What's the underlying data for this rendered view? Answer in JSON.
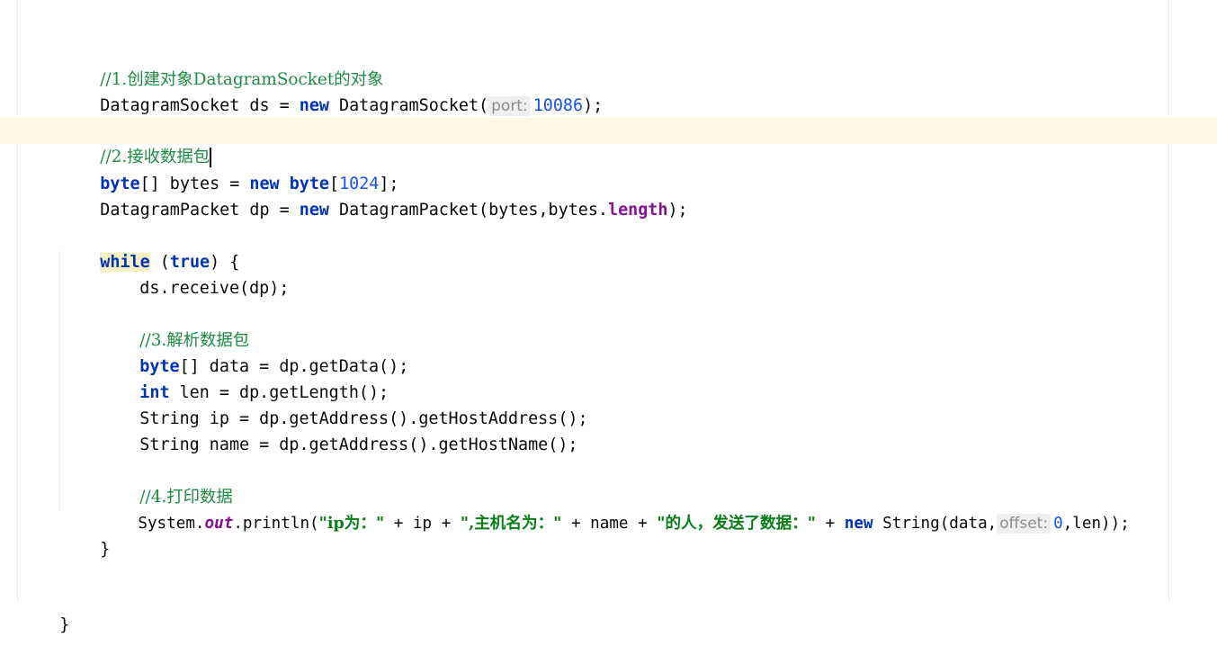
{
  "code": {
    "line1": {
      "comment": "//1.创建对象DatagramSocket的对象"
    },
    "line2": {
      "a": "DatagramSocket ds = ",
      "kw": "new",
      "b": " DatagramSocket(",
      "hint": "port:",
      "num": "10086",
      "c": ");"
    },
    "line4": {
      "comment": "//2.接收数据包"
    },
    "line5": {
      "kw1": "byte",
      "a": "[] bytes = ",
      "kw2": "new",
      "sp": " ",
      "kw3": "byte",
      "b": "[",
      "num": "1024",
      "c": "];"
    },
    "line6": {
      "a": "DatagramPacket dp = ",
      "kw": "new",
      "b": " DatagramPacket(bytes,bytes.",
      "field": "length",
      "c": ");"
    },
    "line8": {
      "kw1": "while",
      "a": " (",
      "kw2": "true",
      "b": ") {"
    },
    "line9": {
      "a": "ds.receive(dp);"
    },
    "line11": {
      "comment": "//3.解析数据包"
    },
    "line12": {
      "kw": "byte",
      "a": "[] data = dp.getData();"
    },
    "line13": {
      "kw": "int",
      "a": " len = dp.getLength();"
    },
    "line14": {
      "a": "String ip = dp.getAddress().getHostAddress();"
    },
    "line15": {
      "a": "String name = dp.getAddress().getHostName();"
    },
    "line17": {
      "comment": "//4.打印数据"
    },
    "line18": {
      "a": "System.",
      "static": "out",
      "b": ".println(",
      "s1": "\"ip为：\"",
      "c": " + ip + ",
      "s2": "\",主机名为：\"",
      "d": " + name + ",
      "s3": "\"的人，发送了数据：\"",
      "e": " + ",
      "kw": "new",
      "f": " String(data,",
      "hint": "offset:",
      "num": "0",
      "g": ",len));"
    },
    "line19": {
      "a": "}"
    },
    "line22": {
      "a": "}"
    }
  }
}
